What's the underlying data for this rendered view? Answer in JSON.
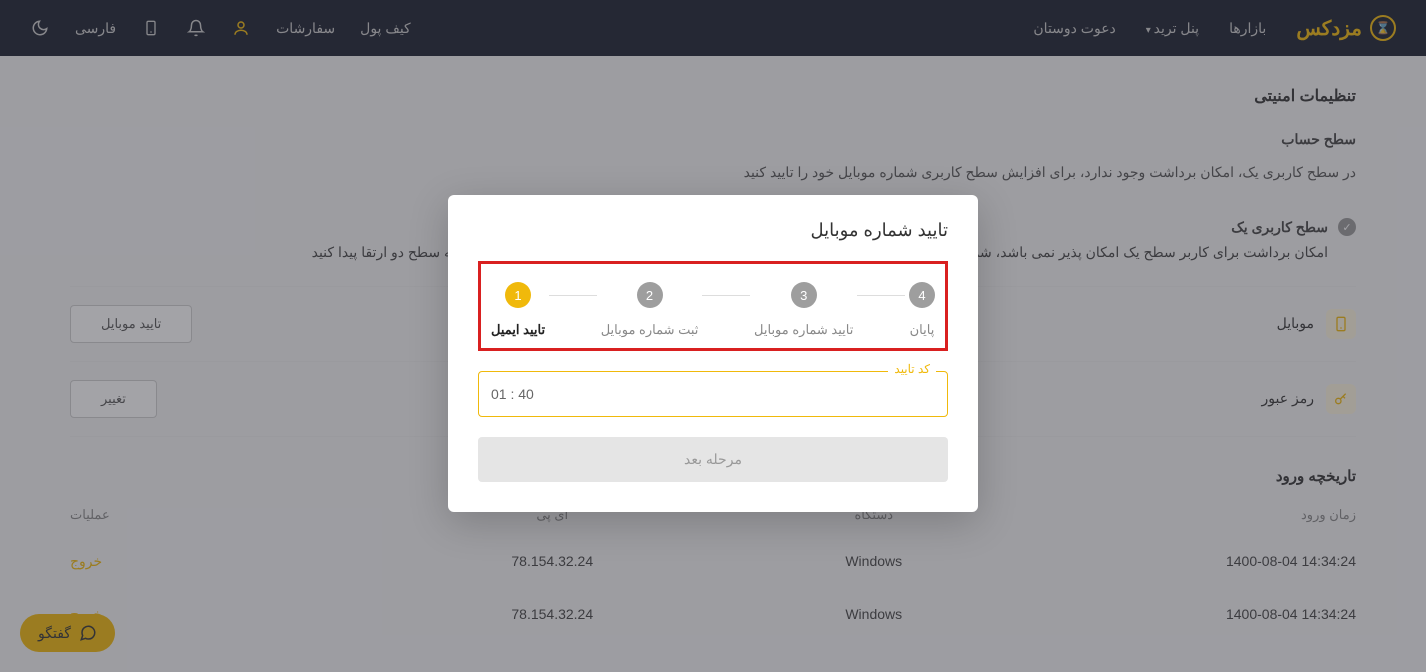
{
  "header": {
    "logo": "مزدکس",
    "nav": {
      "markets": "بازارها",
      "trade_panel": "پنل ترید",
      "invite": "دعوت دوستان",
      "wallet": "کیف پول",
      "orders": "سفارشات"
    },
    "lang": "فارسی"
  },
  "page": {
    "title": "تنظیمات امنیتی",
    "account_level_title": "سطح حساب",
    "account_level_desc": "در سطح کاربری یک، امکان برداشت وجود ندارد، برای افزایش سطح کاربری شماره موبایل خود را تایید کنید",
    "level_name": "سطح کاربری یک",
    "level_desc": "امکان برداشت برای کاربر سطح یک امکان پذیر نمی باشد، شماره موبایل خود را تایید کنید تا سطح کاربری شما افزایش یافته و امکان برداشت ۱۰ هزار تا به سطح دو ارتقا پیدا کنید",
    "mobile": {
      "label": "موبایل",
      "action": "تایید موبایل"
    },
    "password": {
      "label": "رمز عبور",
      "action": "تغییر"
    },
    "login_history_title": "تاریخچه ورود",
    "table": {
      "headers": {
        "time": "زمان ورود",
        "device": "دستگاه",
        "ip": "آی پی",
        "actions": "عملیات"
      },
      "rows": [
        {
          "time": "14:34:24 1400-08-04",
          "device": "Windows",
          "ip": "78.154.32.24",
          "action": "خروج"
        },
        {
          "time": "14:34:24 1400-08-04",
          "device": "Windows",
          "ip": "78.154.32.24",
          "action": "خروج"
        }
      ]
    }
  },
  "modal": {
    "title": "تایید شماره موبایل",
    "steps": [
      {
        "num": "1",
        "label": "تایید ایمیل",
        "active": true
      },
      {
        "num": "2",
        "label": "ثبت شماره موبایل",
        "active": false
      },
      {
        "num": "3",
        "label": "تایید شماره موبایل",
        "active": false
      },
      {
        "num": "4",
        "label": "پایان",
        "active": false
      }
    ],
    "input_label": "کد تایید",
    "timer": "01 : 40",
    "next_button": "مرحله بعد"
  },
  "chat": {
    "label": "گفتگو"
  }
}
